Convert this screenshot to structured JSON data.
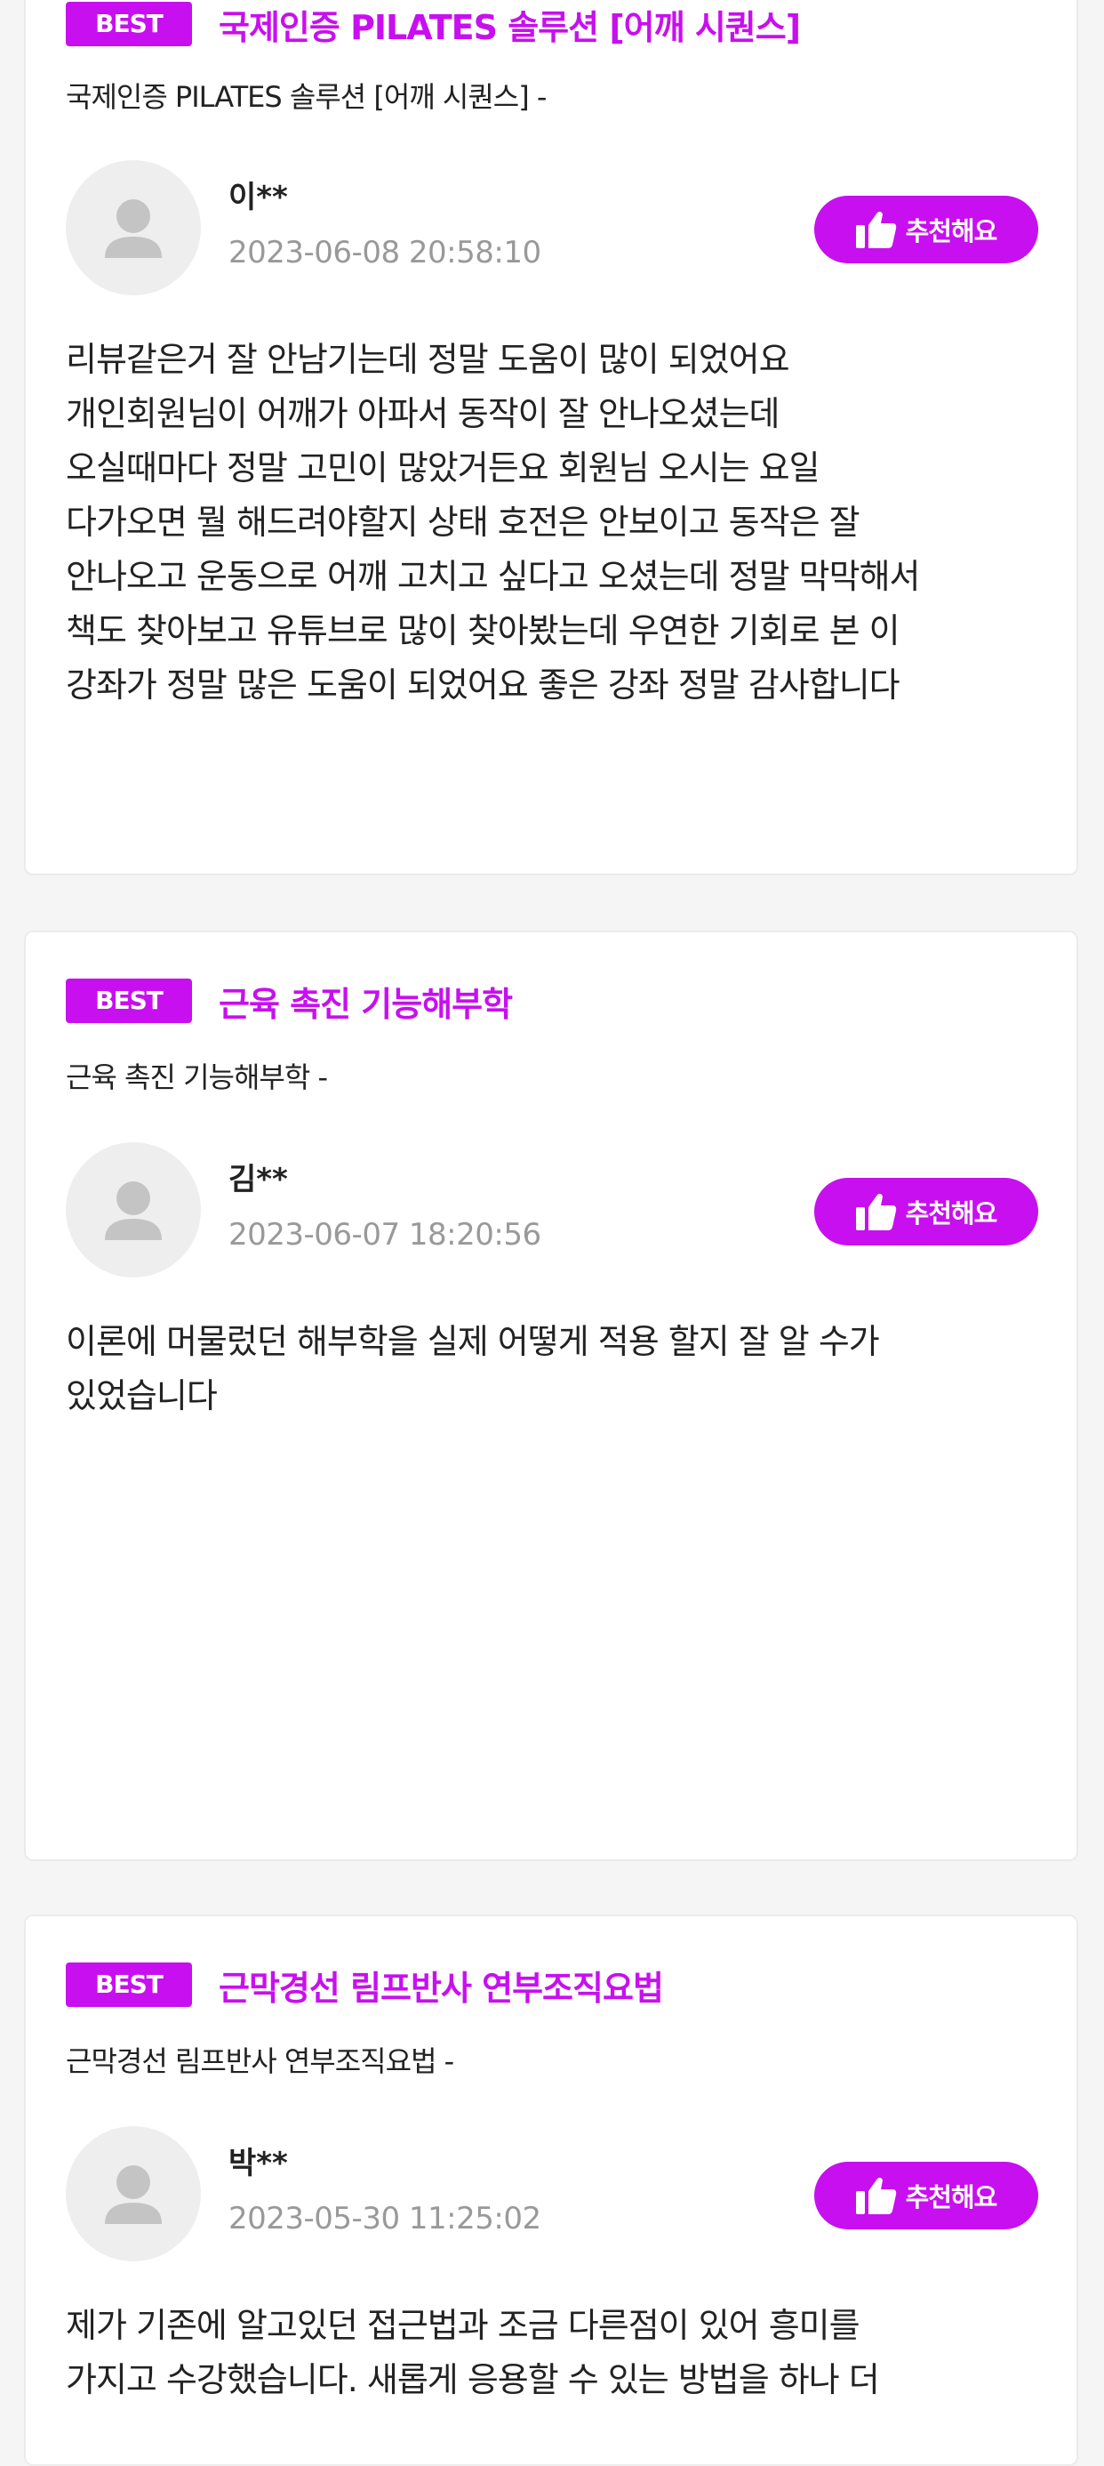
{
  "reviews": [
    {
      "badge": "BEST",
      "title": "국제인증 PILATES 솔루션 [어깨 시퀀스]",
      "subtitle": "국제인증 PILATES 솔루션 [어깨 시퀀스] -",
      "user": "이**",
      "date": "2023-06-08 20:58:10",
      "button_label": "추천해요",
      "text": "리뷰같은거 잘 안남기는데 정말 도움이 많이 되었어요\n개인회원님이 어깨가 아파서 동작이 잘 안나오셨는데\n오실때마다 정말 고민이 많았거든요 회원님 오시는 요일\n다가오면 뭘 해드려야할지 상태 호전은 안보이고 동작은 잘\n안나오고 운동으로 어깨 고치고 싶다고 오셨는데 정말 막막해서\n책도 찾아보고 유튜브로 많이 찾아봤는데 우연한 기회로 본 이\n강좌가 정말 많은 도움이 되었어요 좋은 강좌 정말 감사합니다"
    },
    {
      "badge": "BEST",
      "title": "근육 촉진 기능해부학",
      "subtitle": "근육 촉진 기능해부학 -",
      "user": "김**",
      "date": "2023-06-07 18:20:56",
      "button_label": "추천해요",
      "text": "이론에 머물렀던 해부학을 실제 어떻게 적용 할지 잘 알 수가\n있었습니다"
    },
    {
      "badge": "BEST",
      "title": "근막경선 림프반사 연부조직요법",
      "subtitle": "근막경선 림프반사 연부조직요법 -",
      "user": "박**",
      "date": "2023-05-30 11:25:02",
      "button_label": "추천해요",
      "text": "제가 기존에 알고있던 접근법과 조금 다른점이 있어 흥미를\n가지고 수강했습니다. 새롭게 응용할 수 있는 방법을 하나 더"
    }
  ],
  "colors": {
    "accent": "#c80ff0",
    "page_bg": "#f5f5f5",
    "card_bg": "#ffffff",
    "muted_text": "#999999"
  },
  "icons": {
    "avatar": "user-silhouette-icon",
    "recommend": "thumbs-up-icon"
  }
}
